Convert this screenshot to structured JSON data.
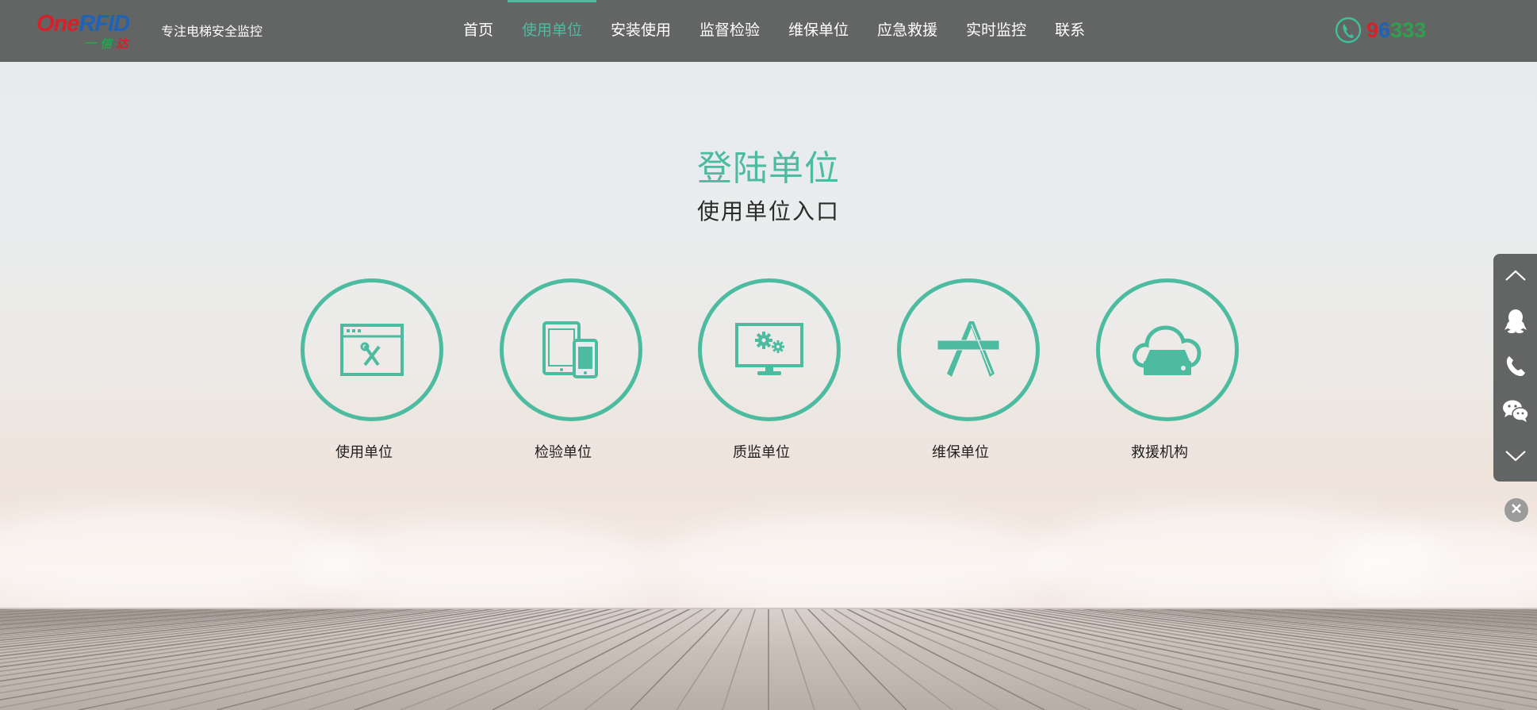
{
  "header": {
    "logo": {
      "word_one": "One",
      "word_rfid": "RFID",
      "sub_a": "一",
      "sub_b": "信",
      "sub_c": "达"
    },
    "slogan": "专注电梯安全监控",
    "nav": [
      {
        "label": "首页",
        "active": false
      },
      {
        "label": "使用单位",
        "active": true
      },
      {
        "label": "安装使用",
        "active": false
      },
      {
        "label": "监督检验",
        "active": false
      },
      {
        "label": "维保单位",
        "active": false
      },
      {
        "label": "应急救援",
        "active": false
      },
      {
        "label": "实时监控",
        "active": false
      },
      {
        "label": "联系",
        "active": false
      }
    ],
    "hotline": {
      "d1": "9",
      "d2": "6",
      "d3": "3",
      "d4": "3",
      "d5": "3",
      "icon": "phone-icon"
    }
  },
  "main": {
    "title": "登陆单位",
    "subtitle": "使用单位入口",
    "entries": [
      {
        "label": "使用单位",
        "icon": "window-tools-icon"
      },
      {
        "label": "检验单位",
        "icon": "tablet-phone-icon"
      },
      {
        "label": "质监单位",
        "icon": "monitor-gears-icon"
      },
      {
        "label": "维保单位",
        "icon": "app-store-icon"
      },
      {
        "label": "救援机构",
        "icon": "cloud-storage-icon"
      }
    ]
  },
  "sidebar": {
    "buttons": [
      "chevron-up-icon",
      "qq-icon",
      "phone-icon",
      "wechat-icon",
      "chevron-down-icon"
    ],
    "close": "close-icon"
  },
  "colors": {
    "accent": "#4dbb9f",
    "header_bg": "#636464",
    "hotline_red": "#d6202a",
    "hotline_blue": "#1f63b6",
    "hotline_green": "#2fa14c"
  }
}
